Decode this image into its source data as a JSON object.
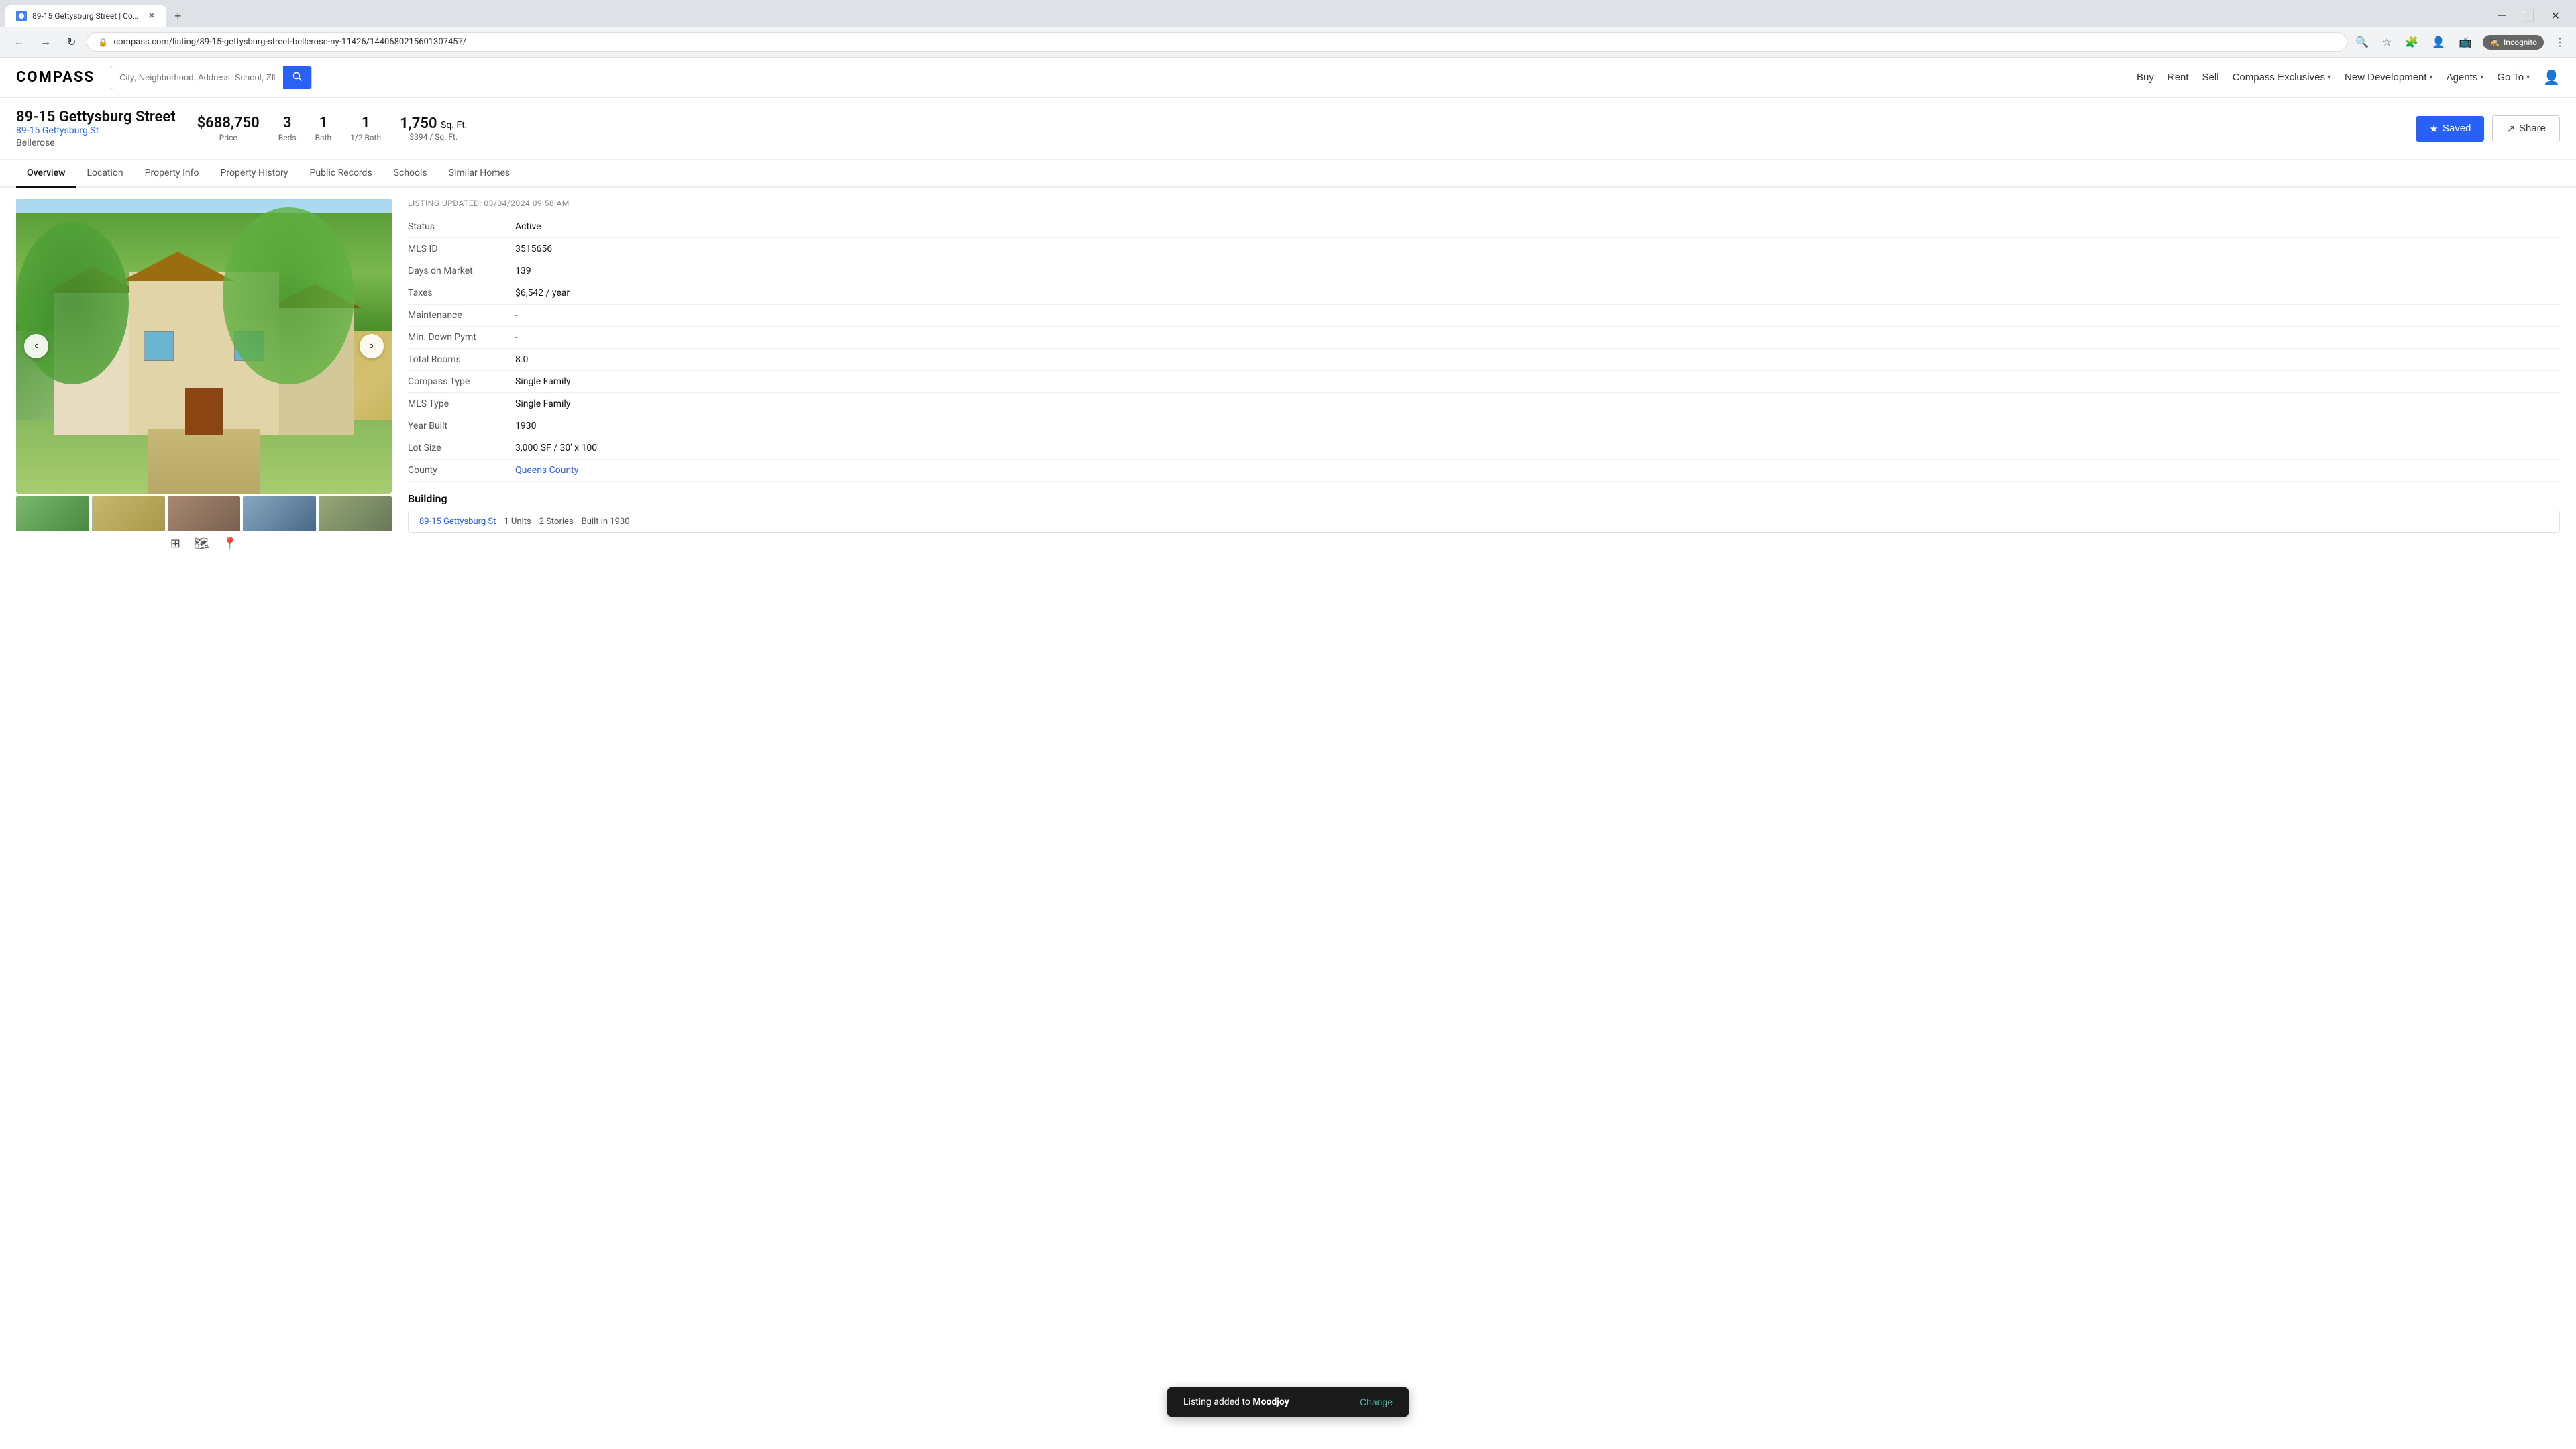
{
  "browser": {
    "tab_title": "89-15 Gettysburg Street | Comp...",
    "url": "compass.com/listing/89-15-gettysburg-street-bellerose-ny-11426/1440680215601307457/",
    "new_tab_label": "+",
    "incognito_label": "Incognito"
  },
  "nav": {
    "logo": "COMPASS",
    "search_placeholder": "City, Neighborhood, Address, School, ZIP, Agent, ID",
    "links": [
      {
        "label": "Buy",
        "has_dropdown": false
      },
      {
        "label": "Rent",
        "has_dropdown": false
      },
      {
        "label": "Sell",
        "has_dropdown": false
      },
      {
        "label": "Compass Exclusives",
        "has_dropdown": true
      },
      {
        "label": "New Development",
        "has_dropdown": true
      },
      {
        "label": "Agents",
        "has_dropdown": true
      },
      {
        "label": "Go To",
        "has_dropdown": true
      }
    ]
  },
  "listing": {
    "address_main": "89-15 Gettysburg Street",
    "address_link": "89-15 Gettysburg St",
    "city": "Bellerose",
    "price": "$688,750",
    "price_label": "Price",
    "beds": "3",
    "beds_label": "Beds",
    "bath": "1",
    "bath_label": "Bath",
    "half_bath": "1",
    "half_bath_label": "1/2 Bath",
    "sqft": "1,750",
    "sqft_label": "Sq. Ft.",
    "price_per_sqft": "$394 / Sq. Ft.",
    "saved_label": "Saved",
    "share_label": "Share"
  },
  "subnav": {
    "items": [
      {
        "label": "Overview",
        "active": true
      },
      {
        "label": "Location",
        "active": false
      },
      {
        "label": "Property Info",
        "active": false
      },
      {
        "label": "Property History",
        "active": false
      },
      {
        "label": "Public Records",
        "active": false
      },
      {
        "label": "Schools",
        "active": false
      },
      {
        "label": "Similar Homes",
        "active": false
      }
    ]
  },
  "details": {
    "listing_updated": "LISTING UPDATED: 03/04/2024 09:58 AM",
    "rows": [
      {
        "label": "Status",
        "value": "Active",
        "is_link": false
      },
      {
        "label": "MLS ID",
        "value": "3515656",
        "is_link": false
      },
      {
        "label": "Days on Market",
        "value": "139",
        "is_link": false
      },
      {
        "label": "Taxes",
        "value": "$6,542 / year",
        "is_link": false
      },
      {
        "label": "Maintenance",
        "value": "-",
        "is_link": false
      },
      {
        "label": "Min. Down Pymt",
        "value": "-",
        "is_link": false
      },
      {
        "label": "Total Rooms",
        "value": "8.0",
        "is_link": false
      },
      {
        "label": "Compass Type",
        "value": "Single Family",
        "is_link": false
      },
      {
        "label": "MLS Type",
        "value": "Single Family",
        "is_link": false
      },
      {
        "label": "Year Built",
        "value": "1930",
        "is_link": false
      },
      {
        "label": "Lot Size",
        "value": "3,000 SF / 30' x 100'",
        "is_link": false
      },
      {
        "label": "County",
        "value": "Queens County",
        "is_link": true
      }
    ],
    "section_building": "Building"
  },
  "bottom_bar": {
    "address_link": "89-15 Gettysburg St",
    "units": "1 Units",
    "stories": "2 Stories",
    "built": "Built in 1930"
  },
  "toast": {
    "message": "Listing added to ",
    "highlight": "Moodjoy",
    "change_label": "Change"
  },
  "thumbnails": [
    1,
    2,
    3,
    4,
    5
  ]
}
